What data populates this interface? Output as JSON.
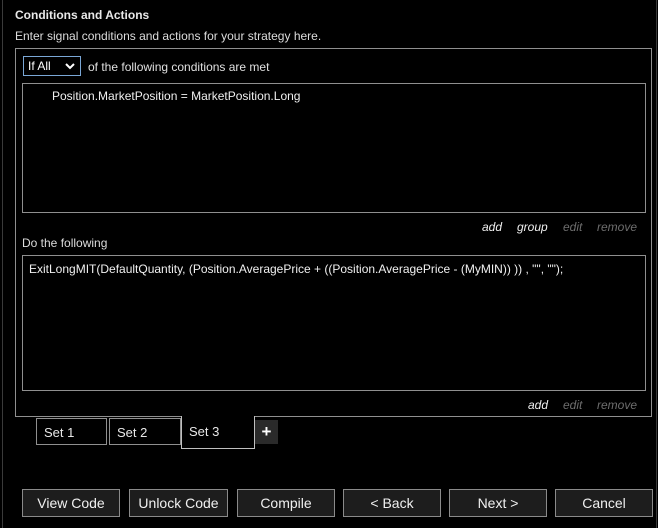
{
  "header": {
    "title": "Conditions and Actions",
    "subtitle": "Enter signal conditions and actions for your strategy here."
  },
  "conditions": {
    "mode_value": "If All",
    "label": "of the following conditions are met",
    "lines": [
      "Position.MarketPosition = MarketPosition.Long"
    ],
    "links": {
      "add": "add",
      "group": "group",
      "edit": "edit",
      "remove": "remove"
    }
  },
  "actions": {
    "label": "Do the following",
    "lines": [
      "ExitLongMIT(DefaultQuantity, (Position.AveragePrice + ((Position.AveragePrice - (MyMIN)) )) , \"\", \"\");"
    ],
    "links": {
      "add": "add",
      "edit": "edit",
      "remove": "remove"
    }
  },
  "tabs": [
    {
      "label": "Set 1",
      "active": false
    },
    {
      "label": "Set 2",
      "active": false
    },
    {
      "label": "Set 3",
      "active": true
    }
  ],
  "add_set_label": "+",
  "buttons": {
    "view_code": "View Code",
    "unlock_code": "Unlock Code",
    "compile": "Compile",
    "back": "< Back",
    "next": "Next >",
    "cancel": "Cancel"
  },
  "icons": {
    "select_arrow": "chevron-down-icon",
    "add_set": "plus-icon"
  }
}
